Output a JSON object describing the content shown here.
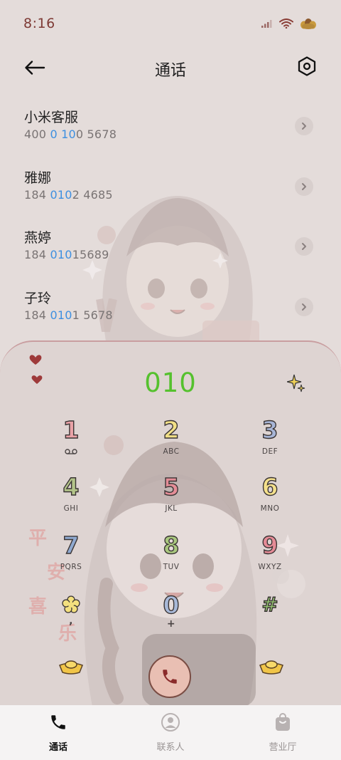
{
  "status": {
    "time": "8:16"
  },
  "header": {
    "title": "通话"
  },
  "contacts": [
    {
      "name": "小米客服",
      "num_a": "400 ",
      "num_hl1": "0",
      "num_b": " ",
      "num_hl2": "10",
      "num_c": "0 5678"
    },
    {
      "name": "雅娜",
      "num_a": "184 ",
      "num_hl1": "010",
      "num_b": "",
      "num_hl2": "",
      "num_c": "2 4685"
    },
    {
      "name": "燕婷",
      "num_a": "184 ",
      "num_hl1": "010",
      "num_b": "",
      "num_hl2": "",
      "num_c": "15689"
    },
    {
      "name": "子玲",
      "num_a": "184 ",
      "num_hl1": "010",
      "num_b": "",
      "num_hl2": "",
      "num_c": "1 5678"
    }
  ],
  "dialer": {
    "input": "010",
    "keys": [
      {
        "digit": "1",
        "letters": "",
        "color": "#e9a2a7"
      },
      {
        "digit": "2",
        "letters": "ABC",
        "color": "#f1df86"
      },
      {
        "digit": "3",
        "letters": "DEF",
        "color": "#a7b5d6"
      },
      {
        "digit": "4",
        "letters": "GHI",
        "color": "#b3c489"
      },
      {
        "digit": "5",
        "letters": "JKL",
        "color": "#e48d97"
      },
      {
        "digit": "6",
        "letters": "MNO",
        "color": "#f4e08b"
      },
      {
        "digit": "7",
        "letters": "PQRS",
        "color": "#8fa9d0"
      },
      {
        "digit": "8",
        "letters": "TUV",
        "color": "#a9c77e"
      },
      {
        "digit": "9",
        "letters": "WXYZ",
        "color": "#e48b96"
      },
      {
        "digit": "*",
        "letters": ",",
        "color": "#f3e07e"
      },
      {
        "digit": "0",
        "letters": "+",
        "color": "#a8b9d8"
      },
      {
        "digit": "#",
        "letters": "",
        "color": "#93c06f"
      }
    ],
    "call_icon": "phone-icon"
  },
  "decor": {
    "blessing": [
      "平",
      "安",
      "喜",
      "乐"
    ]
  },
  "tabs": [
    {
      "label": "通话",
      "icon": "phone-icon",
      "active": true
    },
    {
      "label": "联系人",
      "icon": "person-icon",
      "active": false
    },
    {
      "label": "营业厅",
      "icon": "shopping-bag-icon",
      "active": false
    }
  ],
  "colors": {
    "accent_green": "#55c12e",
    "highlight_blue": "#3d8fe0",
    "status_red": "#7e3a35"
  }
}
